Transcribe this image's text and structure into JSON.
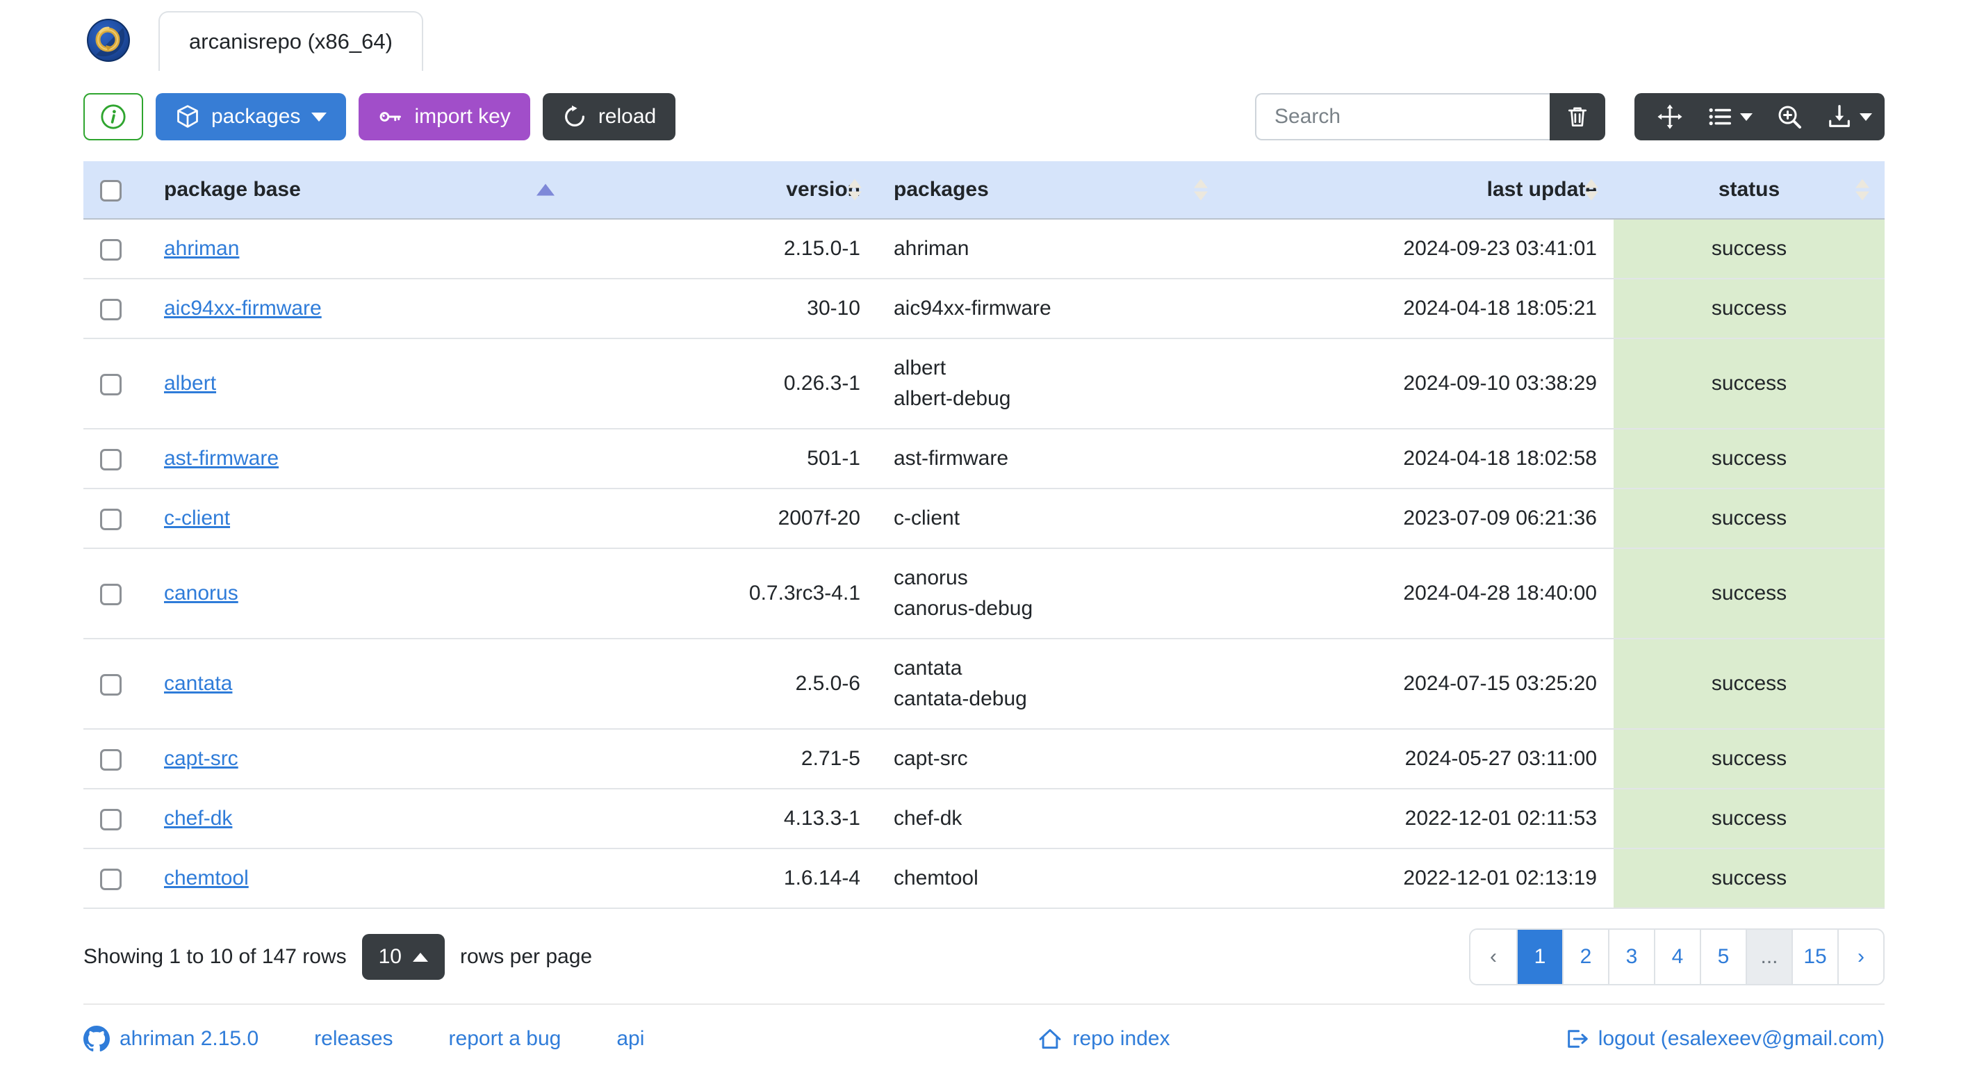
{
  "window": {
    "tab_title": "arcanisrepo (x86_64)"
  },
  "toolbar": {
    "packages_label": "packages",
    "import_key_label": "import key",
    "reload_label": "reload",
    "search_placeholder": "Search"
  },
  "icons": {
    "app_logo": "ahriman-dragon-ring-logo",
    "info": "info-circle",
    "packages": "box-cube",
    "import_key": "key",
    "reload": "arrow-clockwise",
    "clear_search": "trash",
    "fullscreen": "arrows-move",
    "columns": "list-ul + caret-down",
    "toggle_view": "zoom-in-magnifier",
    "export": "download + caret-down",
    "sorted_ascending": "caret-up-filled",
    "sortable": "caret-up-down-faint",
    "github": "github-octocat",
    "repo_index": "house",
    "logout": "box-arrow-right"
  },
  "colors": {
    "accent_blue": "#377dd5",
    "link_blue": "#2f7cd9",
    "purple": "#a14ec9",
    "dark": "#383d41",
    "green_outline": "#2fa52f",
    "header_bg": "#d6e4fa",
    "status_success_bg": "#dbeccf",
    "sort_active_caret": "#7e88d8"
  },
  "table": {
    "columns": [
      "package base",
      "version",
      "packages",
      "last update",
      "status"
    ],
    "sorted_column": "package base",
    "sort_direction": "asc",
    "rows": [
      {
        "base": "ahriman",
        "version": "2.15.0-1",
        "packages": [
          "ahriman"
        ],
        "last_update": "2024-09-23 03:41:01",
        "status": "success"
      },
      {
        "base": "aic94xx-firmware",
        "version": "30-10",
        "packages": [
          "aic94xx-firmware"
        ],
        "last_update": "2024-04-18 18:05:21",
        "status": "success"
      },
      {
        "base": "albert",
        "version": "0.26.3-1",
        "packages": [
          "albert",
          "albert-debug"
        ],
        "last_update": "2024-09-10 03:38:29",
        "status": "success"
      },
      {
        "base": "ast-firmware",
        "version": "501-1",
        "packages": [
          "ast-firmware"
        ],
        "last_update": "2024-04-18 18:02:58",
        "status": "success"
      },
      {
        "base": "c-client",
        "version": "2007f-20",
        "packages": [
          "c-client"
        ],
        "last_update": "2023-07-09 06:21:36",
        "status": "success"
      },
      {
        "base": "canorus",
        "version": "0.7.3rc3-4.1",
        "packages": [
          "canorus",
          "canorus-debug"
        ],
        "last_update": "2024-04-28 18:40:00",
        "status": "success"
      },
      {
        "base": "cantata",
        "version": "2.5.0-6",
        "packages": [
          "cantata",
          "cantata-debug"
        ],
        "last_update": "2024-07-15 03:25:20",
        "status": "success"
      },
      {
        "base": "capt-src",
        "version": "2.71-5",
        "packages": [
          "capt-src"
        ],
        "last_update": "2024-05-27 03:11:00",
        "status": "success"
      },
      {
        "base": "chef-dk",
        "version": "4.13.3-1",
        "packages": [
          "chef-dk"
        ],
        "last_update": "2022-12-01 02:11:53",
        "status": "success"
      },
      {
        "base": "chemtool",
        "version": "1.6.14-4",
        "packages": [
          "chemtool"
        ],
        "last_update": "2022-12-01 02:13:19",
        "status": "success"
      }
    ]
  },
  "pagination": {
    "summary": "Showing 1 to 10 of 147 rows",
    "page_size": "10",
    "rows_per_page_label": "rows per page",
    "prev_label": "‹",
    "next_label": "›",
    "pages": [
      "1",
      "2",
      "3",
      "4",
      "5",
      "...",
      "15"
    ],
    "active_page": "1"
  },
  "footer": {
    "version_link": "ahriman 2.15.0",
    "releases_label": "releases",
    "report_bug_label": "report a bug",
    "api_label": "api",
    "repo_index_label": "repo index",
    "logout_label": "logout (esalexeev@gmail.com)"
  }
}
